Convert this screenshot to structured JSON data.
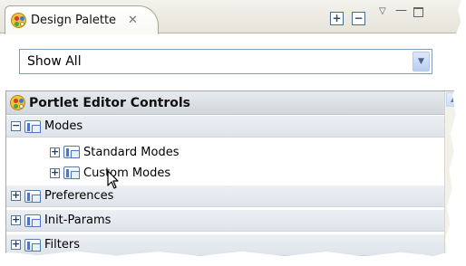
{
  "view_tab": {
    "label": "Design Palette",
    "close_glyph": "✕",
    "icon": "palette-icon"
  },
  "view_toolbar": {
    "expand_glyph": "+",
    "collapse_glyph": "−",
    "menu_glyph": "▽",
    "minimize_glyph": "—"
  },
  "filter": {
    "selected": "Show All",
    "dropdown_glyph": "▼"
  },
  "drawer": {
    "title": "Portlet Editor Controls",
    "icon": "palette-icon",
    "items": [
      {
        "label": "Modes",
        "toggle": "−"
      },
      {
        "label": "Standard Modes",
        "toggle": "+"
      },
      {
        "label": "Custom Modes",
        "toggle": "+"
      },
      {
        "label": "Preferences",
        "toggle": "+"
      },
      {
        "label": "Init-Params",
        "toggle": "+"
      },
      {
        "label": "Filters",
        "toggle": "+"
      }
    ]
  },
  "scrollbar": {
    "up_glyph": "▲"
  }
}
